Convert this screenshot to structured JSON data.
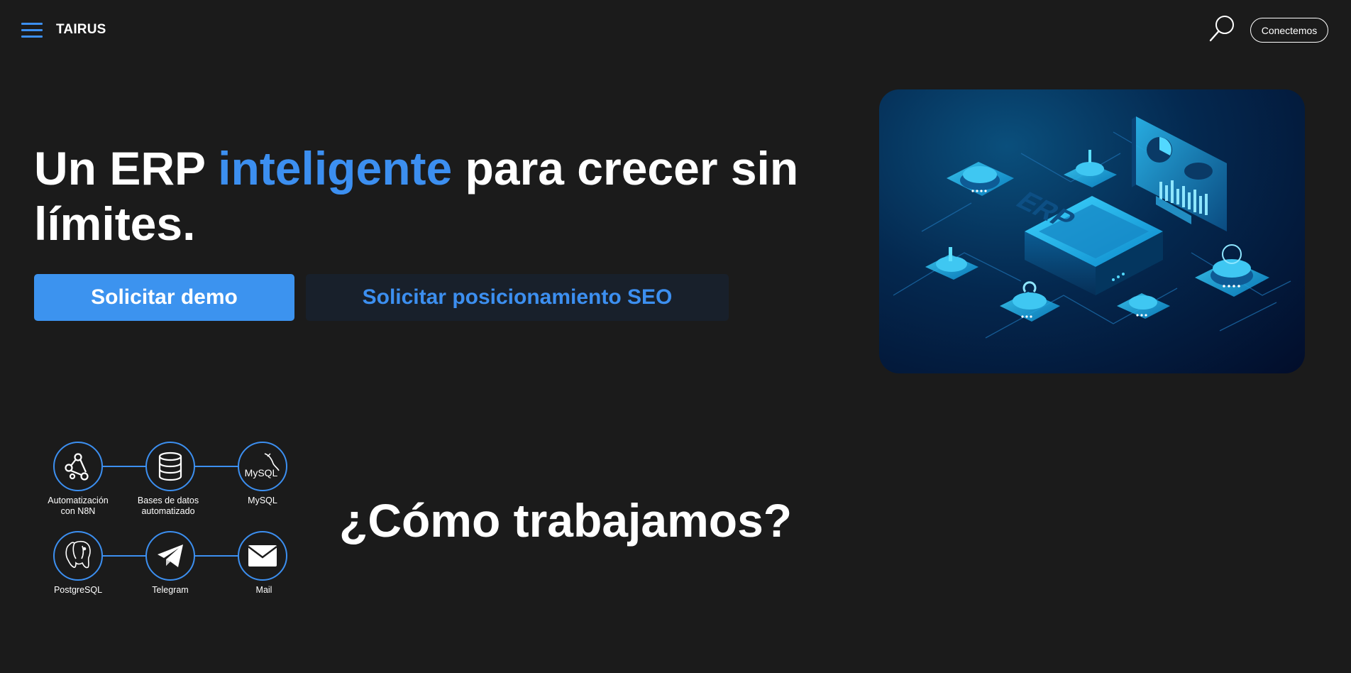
{
  "header": {
    "brand": "TAIRUS",
    "connect_label": "Conectemos",
    "menu_icon": "hamburger-menu-icon",
    "search_icon": "search-icon"
  },
  "hero": {
    "title_part1": "Un ERP ",
    "title_accent": "inteligente",
    "title_part2": " para crecer sin límites.",
    "demo_button": "Solicitar demo",
    "seo_button": "Solicitar posicionamiento SEO",
    "image": {
      "badge": "ERP"
    }
  },
  "integrations": {
    "items": [
      {
        "label": "Automatización\ncon N8N",
        "icon": "workflow-nodes-icon"
      },
      {
        "label": "Bases de datos\nautomatizado",
        "icon": "database-icon"
      },
      {
        "label": "MySQL",
        "icon": "mysql-logo-icon",
        "logo_text": "MySQL"
      },
      {
        "label": "PostgreSQL",
        "icon": "postgresql-elephant-icon"
      },
      {
        "label": "Telegram",
        "icon": "telegram-plane-icon"
      },
      {
        "label": "Mail",
        "icon": "mail-envelope-icon"
      }
    ]
  },
  "section": {
    "how_title": "¿Cómo trabajamos?"
  },
  "colors": {
    "background": "#1b1b1b",
    "accent": "#3c8ff0",
    "seo_button_bg": "#18202b",
    "text": "#ffffff"
  }
}
